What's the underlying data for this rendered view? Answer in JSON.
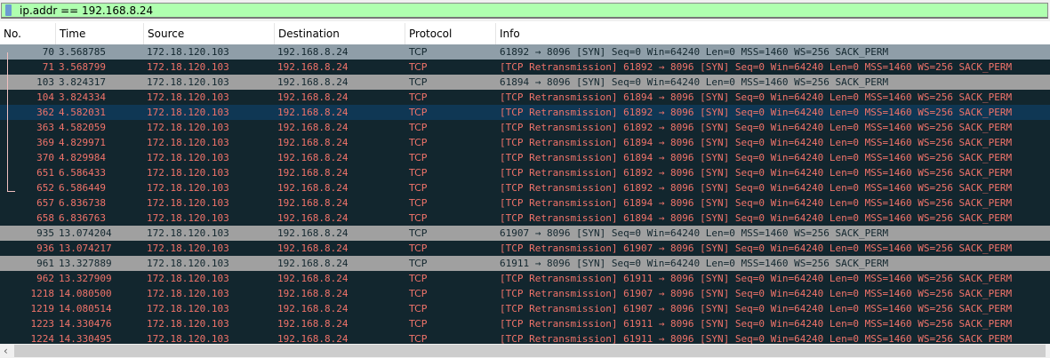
{
  "filter": {
    "value": "ip.addr == 192.168.8.24"
  },
  "columns": [
    "No.",
    "Time",
    "Source",
    "Destination",
    "Protocol",
    "Info"
  ],
  "colors": {
    "row_bg": "#12262e",
    "row_fg": "#f0736a",
    "gray": "#a0a0a0",
    "selected": "#0f3754",
    "filter_ok": "#afffaf"
  },
  "rows": [
    {
      "no": "70",
      "time": "3.568785",
      "src": "172.18.120.103",
      "dst": "192.168.8.24",
      "proto": "TCP",
      "info": "61892 → 8096 [SYN] Seq=0 Win=64240 Len=0 MSS=1460 WS=256 SACK_PERM",
      "style": "first"
    },
    {
      "no": "71",
      "time": "3.568799",
      "src": "172.18.120.103",
      "dst": "192.168.8.24",
      "proto": "TCP",
      "info": "[TCP Retransmission] 61892 → 8096 [SYN] Seq=0 Win=64240 Len=0 MSS=1460 WS=256 SACK_PERM",
      "style": ""
    },
    {
      "no": "103",
      "time": "3.824317",
      "src": "172.18.120.103",
      "dst": "192.168.8.24",
      "proto": "TCP",
      "info": "61894 → 8096 [SYN] Seq=0 Win=64240 Len=0 MSS=1460 WS=256 SACK_PERM",
      "style": "gray"
    },
    {
      "no": "104",
      "time": "3.824334",
      "src": "172.18.120.103",
      "dst": "192.168.8.24",
      "proto": "TCP",
      "info": "[TCP Retransmission] 61894 → 8096 [SYN] Seq=0 Win=64240 Len=0 MSS=1460 WS=256 SACK_PERM",
      "style": ""
    },
    {
      "no": "362",
      "time": "4.582031",
      "src": "172.18.120.103",
      "dst": "192.168.8.24",
      "proto": "TCP",
      "info": "[TCP Retransmission] 61892 → 8096 [SYN] Seq=0 Win=64240 Len=0 MSS=1460 WS=256 SACK_PERM",
      "style": "sel"
    },
    {
      "no": "363",
      "time": "4.582059",
      "src": "172.18.120.103",
      "dst": "192.168.8.24",
      "proto": "TCP",
      "info": "[TCP Retransmission] 61892 → 8096 [SYN] Seq=0 Win=64240 Len=0 MSS=1460 WS=256 SACK_PERM",
      "style": ""
    },
    {
      "no": "369",
      "time": "4.829971",
      "src": "172.18.120.103",
      "dst": "192.168.8.24",
      "proto": "TCP",
      "info": "[TCP Retransmission] 61894 → 8096 [SYN] Seq=0 Win=64240 Len=0 MSS=1460 WS=256 SACK_PERM",
      "style": ""
    },
    {
      "no": "370",
      "time": "4.829984",
      "src": "172.18.120.103",
      "dst": "192.168.8.24",
      "proto": "TCP",
      "info": "[TCP Retransmission] 61894 → 8096 [SYN] Seq=0 Win=64240 Len=0 MSS=1460 WS=256 SACK_PERM",
      "style": ""
    },
    {
      "no": "651",
      "time": "6.586433",
      "src": "172.18.120.103",
      "dst": "192.168.8.24",
      "proto": "TCP",
      "info": "[TCP Retransmission] 61892 → 8096 [SYN] Seq=0 Win=64240 Len=0 MSS=1460 WS=256 SACK_PERM",
      "style": ""
    },
    {
      "no": "652",
      "time": "6.586449",
      "src": "172.18.120.103",
      "dst": "192.168.8.24",
      "proto": "TCP",
      "info": "[TCP Retransmission] 61892 → 8096 [SYN] Seq=0 Win=64240 Len=0 MSS=1460 WS=256 SACK_PERM",
      "style": ""
    },
    {
      "no": "657",
      "time": "6.836738",
      "src": "172.18.120.103",
      "dst": "192.168.8.24",
      "proto": "TCP",
      "info": "[TCP Retransmission] 61894 → 8096 [SYN] Seq=0 Win=64240 Len=0 MSS=1460 WS=256 SACK_PERM",
      "style": ""
    },
    {
      "no": "658",
      "time": "6.836763",
      "src": "172.18.120.103",
      "dst": "192.168.8.24",
      "proto": "TCP",
      "info": "[TCP Retransmission] 61894 → 8096 [SYN] Seq=0 Win=64240 Len=0 MSS=1460 WS=256 SACK_PERM",
      "style": ""
    },
    {
      "no": "935",
      "time": "13.074204",
      "src": "172.18.120.103",
      "dst": "192.168.8.24",
      "proto": "TCP",
      "info": "61907 → 8096 [SYN] Seq=0 Win=64240 Len=0 MSS=1460 WS=256 SACK_PERM",
      "style": "gray"
    },
    {
      "no": "936",
      "time": "13.074217",
      "src": "172.18.120.103",
      "dst": "192.168.8.24",
      "proto": "TCP",
      "info": "[TCP Retransmission] 61907 → 8096 [SYN] Seq=0 Win=64240 Len=0 MSS=1460 WS=256 SACK_PERM",
      "style": ""
    },
    {
      "no": "961",
      "time": "13.327889",
      "src": "172.18.120.103",
      "dst": "192.168.8.24",
      "proto": "TCP",
      "info": "61911 → 8096 [SYN] Seq=0 Win=64240 Len=0 MSS=1460 WS=256 SACK_PERM",
      "style": "gray"
    },
    {
      "no": "962",
      "time": "13.327909",
      "src": "172.18.120.103",
      "dst": "192.168.8.24",
      "proto": "TCP",
      "info": "[TCP Retransmission] 61911 → 8096 [SYN] Seq=0 Win=64240 Len=0 MSS=1460 WS=256 SACK_PERM",
      "style": ""
    },
    {
      "no": "1218",
      "time": "14.080500",
      "src": "172.18.120.103",
      "dst": "192.168.8.24",
      "proto": "TCP",
      "info": "[TCP Retransmission] 61907 → 8096 [SYN] Seq=0 Win=64240 Len=0 MSS=1460 WS=256 SACK_PERM",
      "style": ""
    },
    {
      "no": "1219",
      "time": "14.080514",
      "src": "172.18.120.103",
      "dst": "192.168.8.24",
      "proto": "TCP",
      "info": "[TCP Retransmission] 61907 → 8096 [SYN] Seq=0 Win=64240 Len=0 MSS=1460 WS=256 SACK_PERM",
      "style": ""
    },
    {
      "no": "1223",
      "time": "14.330476",
      "src": "172.18.120.103",
      "dst": "192.168.8.24",
      "proto": "TCP",
      "info": "[TCP Retransmission] 61911 → 8096 [SYN] Seq=0 Win=64240 Len=0 MSS=1460 WS=256 SACK_PERM",
      "style": ""
    },
    {
      "no": "1224",
      "time": "14.330495",
      "src": "172.18.120.103",
      "dst": "192.168.8.24",
      "proto": "TCP",
      "info": "[TCP Retransmission] 61911 → 8096 [SYN] Seq=0 Win=64240 Len=0 MSS=1460 WS=256 SACK_PERM",
      "style": ""
    }
  ],
  "scrollbar": {
    "left_arrow": "‹"
  }
}
